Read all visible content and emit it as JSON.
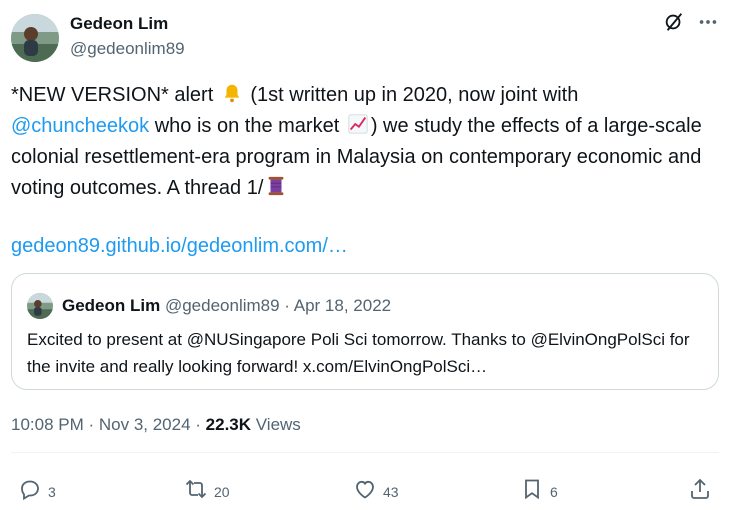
{
  "author": {
    "name": "Gedeon Lim",
    "handle": "@gedeonlim89"
  },
  "tweet": {
    "text_part1": "*NEW VERSION* alert",
    "text_part2": " (1st written up in 2020, now joint with ",
    "mention": "@chuncheekok",
    "text_part3": " who is on the market ",
    "text_part4": ") we study the effects of a large-scale colonial resettlement-era program in Malaysia on contemporary economic and voting outcomes. A thread 1/",
    "link": "gedeon89.github.io/gedeonlim.com/…"
  },
  "emojis": {
    "bell": "bell-emoji",
    "chart": "chart-increasing-emoji",
    "thread": "spool-of-thread-emoji"
  },
  "quote": {
    "name": "Gedeon Lim",
    "handle": "@gedeonlim89",
    "separator": " · ",
    "date": "Apr 18, 2022",
    "text": "Excited to present at @NUSingapore Poli Sci tomorrow. Thanks to @ElvinOngPolSci for the invite and really looking forward! x.com/ElvinOngPolSci…"
  },
  "meta": {
    "time": "10:08 PM",
    "separator": " · ",
    "date": "Nov 3, 2024",
    "views_count": "22.3K",
    "views_label": " Views"
  },
  "actions": {
    "reply_count": "3",
    "retweet_count": "20",
    "like_count": "43",
    "bookmark_count": "6"
  },
  "colors": {
    "accent": "#1d9bf0",
    "text": "#0f1419",
    "muted": "#536471",
    "border": "#cfd9de"
  }
}
